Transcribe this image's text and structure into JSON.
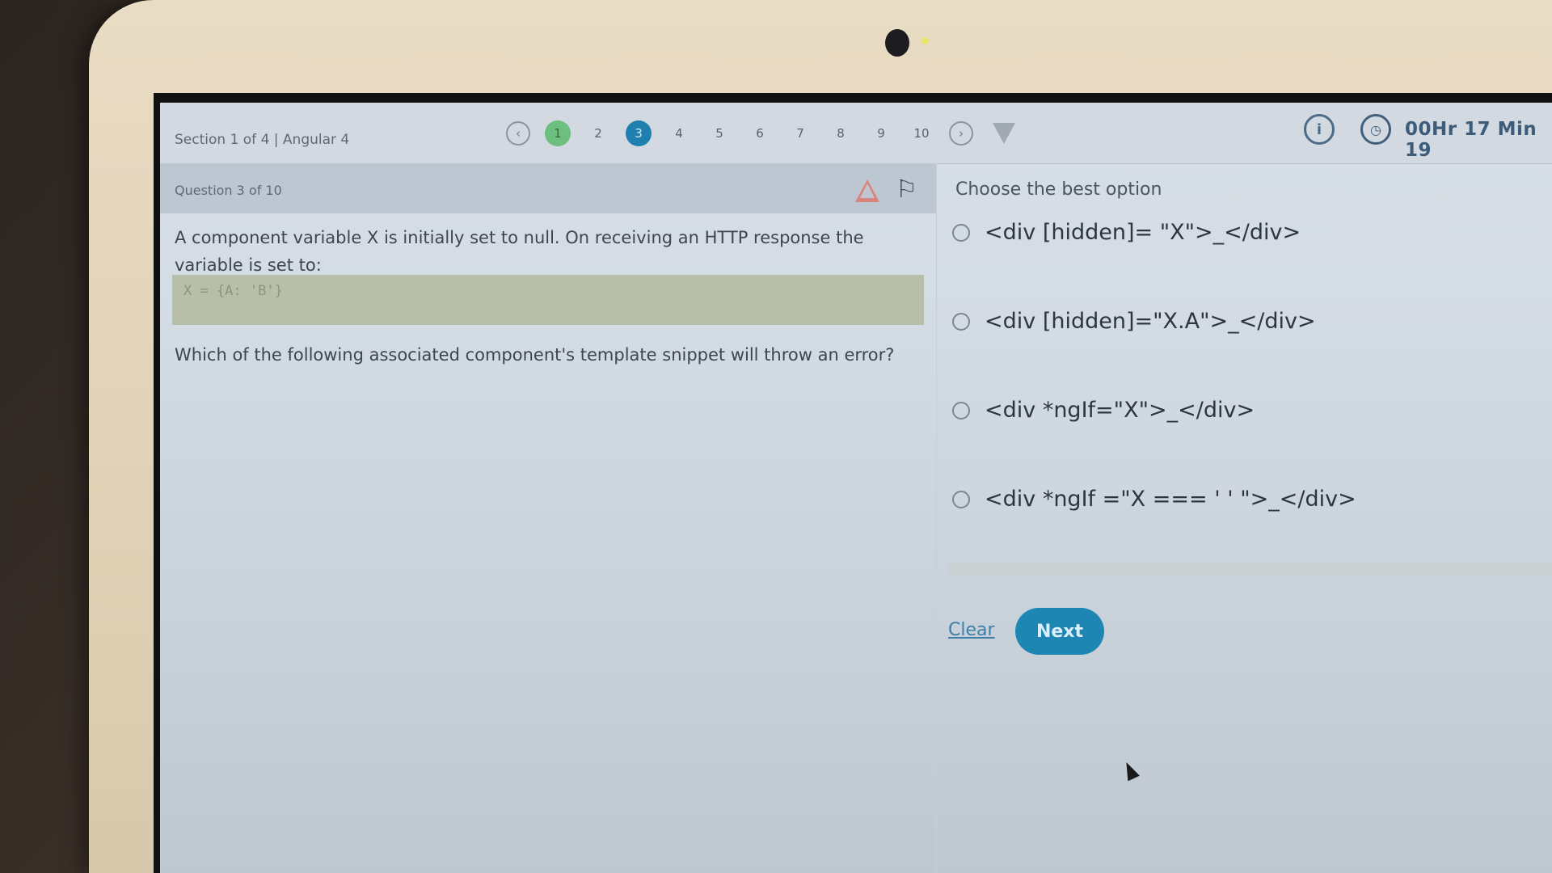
{
  "header": {
    "section_label": "Section 1 of 4 | Angular 4",
    "question_numbers": [
      "1",
      "2",
      "3",
      "4",
      "5",
      "6",
      "7",
      "8",
      "9",
      "10"
    ],
    "answered_index": 0,
    "current_index": 2,
    "prev_glyph": "‹",
    "next_glyph": "›",
    "timer": "00Hr 17  Min 19"
  },
  "question": {
    "label": "Question 3 of 10",
    "text": "A component variable X is initially set to null. On receiving an HTTP response the variable is set to:",
    "code": "X = {A: 'B'}",
    "prompt": "Which of the following associated component's template snippet will throw an error?"
  },
  "options": {
    "heading": "Choose the best option",
    "items": [
      "<div [hidden]= \"X\">_</div>",
      "<div [hidden]=\"X.A\">_</div>",
      "<div *ngIf=\"X\">_</div>",
      "<div *ngIf =\"X === ' ' \">_</div>"
    ]
  },
  "actions": {
    "clear_label": "Clear",
    "next_label": "Next"
  }
}
